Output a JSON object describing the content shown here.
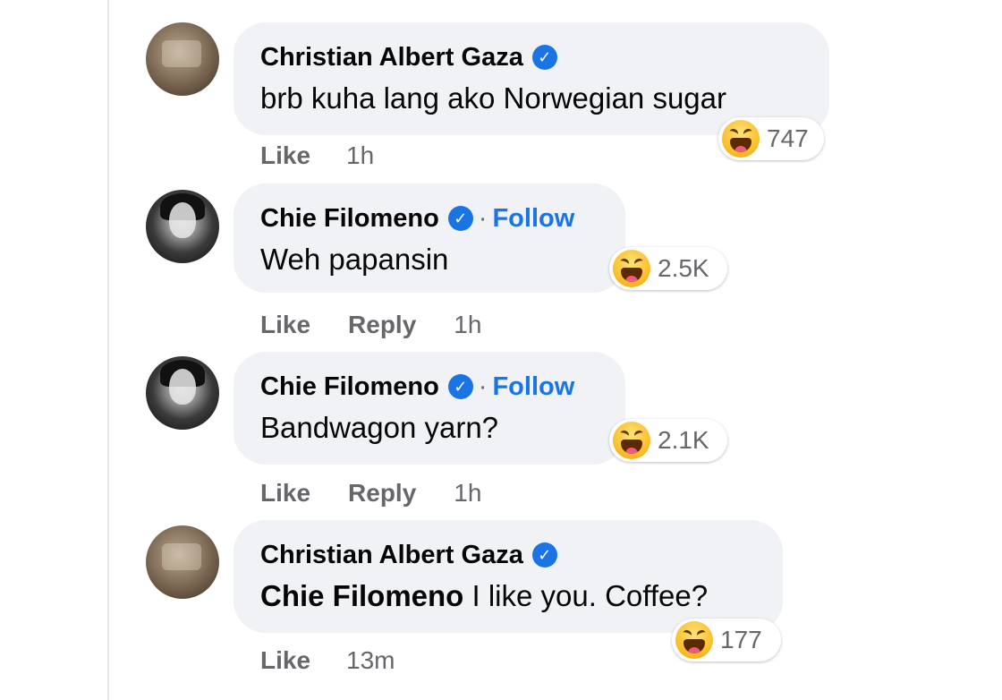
{
  "comments": [
    {
      "author": "Christian Albert Gaza",
      "text": "brb kuha lang ako Norwegian sugar",
      "reaction": {
        "icon": "haha-emoji-icon",
        "count": "747"
      },
      "like": "Like",
      "time": "1h"
    },
    {
      "author": "Chie Filomeno",
      "separator": "·",
      "follow": "Follow",
      "text": "Weh papansin",
      "reaction": {
        "icon": "haha-emoji-icon",
        "count": "2.5K"
      },
      "like": "Like",
      "reply": "Reply",
      "time": "1h"
    },
    {
      "author": "Chie Filomeno",
      "separator": "·",
      "follow": "Follow",
      "text": "Bandwagon yarn?",
      "reaction": {
        "icon": "haha-emoji-icon",
        "count": "2.1K"
      },
      "like": "Like",
      "reply": "Reply",
      "time": "1h"
    },
    {
      "author": "Christian Albert Gaza",
      "mention": "Chie Filomeno",
      "text": " I like you. Coffee?",
      "reaction": {
        "icon": "haha-emoji-icon",
        "count": "177"
      },
      "like": "Like",
      "time": "13m"
    }
  ],
  "colors": {
    "bubble": "#f0f2f5",
    "link": "#1b74e4",
    "muted": "#65676b",
    "verified": "#1b74e4"
  },
  "icons": {
    "verified": "verified-badge-icon",
    "reaction": "haha-emoji-icon"
  }
}
